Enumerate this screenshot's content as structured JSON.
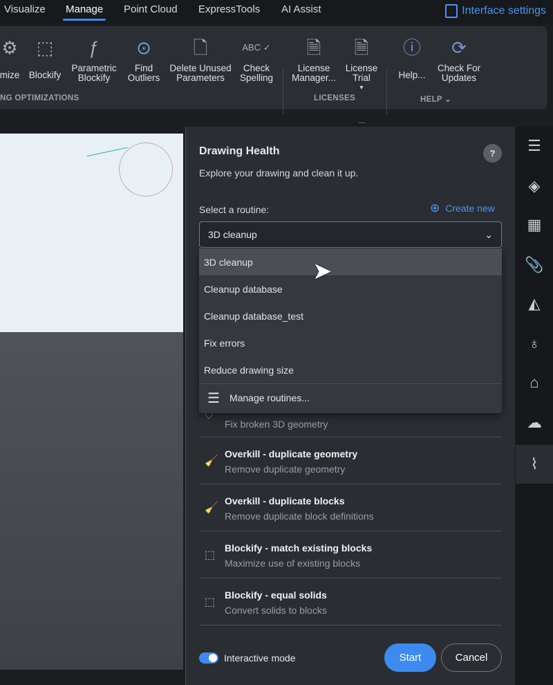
{
  "tabs": [
    {
      "label": "Visualize"
    },
    {
      "label": "Manage",
      "active": true
    },
    {
      "label": "Point Cloud"
    },
    {
      "label": "ExpressTools"
    },
    {
      "label": "AI Assist"
    }
  ],
  "interface_settings": "Interface settings",
  "ribbon": {
    "buttons": [
      {
        "label": "mize",
        "icon": "optimize-icon"
      },
      {
        "label": "Blockify",
        "icon": "blockify-icon"
      },
      {
        "label": "Parametric Blockify",
        "icon": "parametric-blockify-icon"
      },
      {
        "label": "Find Outliers",
        "icon": "find-outliers-icon"
      },
      {
        "label": "Delete Unused Parameters",
        "icon": "delete-unused-icon"
      },
      {
        "label": "Check Spelling",
        "icon": "check-spelling-icon"
      },
      {
        "label": "License Manager...",
        "icon": "license-manager-icon"
      },
      {
        "label": "License Trial",
        "icon": "license-trial-icon"
      },
      {
        "label": "Help...",
        "icon": "help-icon"
      },
      {
        "label": "Check For Updates",
        "icon": "check-updates-icon"
      }
    ],
    "groups": [
      "NG OPTIMIZATIONS",
      "LICENSES",
      "HELP"
    ]
  },
  "panel": {
    "title": "Drawing Health",
    "subtitle": "Explore your drawing and clean it up.",
    "select_label": "Select a routine:",
    "create_new": "Create new",
    "selected": "3D cleanup",
    "options": [
      "3D cleanup",
      "Cleanup database",
      "Cleanup database_test",
      "Fix errors",
      "Reduce drawing size"
    ],
    "manage_routines": "Manage routines...",
    "steps": [
      {
        "title": "",
        "desc": "Fix broken 3D geometry"
      },
      {
        "title": "Overkill - duplicate geometry",
        "desc": "Remove duplicate geometry"
      },
      {
        "title": "Overkill - duplicate blocks",
        "desc": "Remove duplicate block definitions"
      },
      {
        "title": "Blockify - match existing blocks",
        "desc": "Maximize use of existing blocks"
      },
      {
        "title": "Blockify - equal solids",
        "desc": "Convert solids to blocks"
      }
    ],
    "interactive_mode": "Interactive mode",
    "interactive_on": true,
    "start": "Start",
    "cancel": "Cancel"
  },
  "colors": {
    "accent": "#3d8bf0",
    "panel": "#2a2d32"
  }
}
